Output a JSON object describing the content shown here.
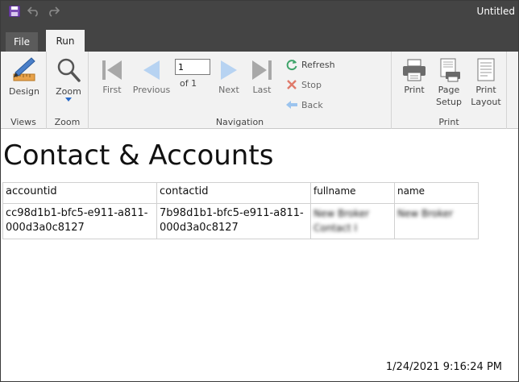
{
  "window": {
    "title": "Untitled"
  },
  "tabs": {
    "file": "File",
    "run": "Run"
  },
  "ribbon": {
    "views": {
      "design": "Design",
      "label": "Views"
    },
    "zoom": {
      "zoom": "Zoom",
      "label": "Zoom"
    },
    "navigation": {
      "first": "First",
      "previous": "Previous",
      "page_value": "1",
      "of_text": "of  1",
      "next": "Next",
      "last": "Last",
      "refresh": "Refresh",
      "stop": "Stop",
      "back": "Back",
      "label": "Navigation"
    },
    "print": {
      "print": "Print",
      "page_setup": "Page Setup",
      "print_layout": "Print Layout",
      "label": "Print"
    }
  },
  "report": {
    "title": "Contact & Accounts",
    "columns": [
      "accountid",
      "contactid",
      "fullname",
      "name"
    ],
    "rows": [
      {
        "accountid": "cc98d1b1-bfc5-e911-a811-000d3a0c8127",
        "contactid": "7b98d1b1-bfc5-e911-a811-000d3a0c8127",
        "fullname": "New Broker Contact I",
        "name": "New Broker"
      }
    ],
    "timestamp": "1/24/2021 9:16:24 PM"
  },
  "colors": {
    "titlebar": "#444444",
    "ribbon": "#f2f2f2",
    "accent_blue": "#5aa0e0",
    "save_purple": "#6b3fa0"
  }
}
